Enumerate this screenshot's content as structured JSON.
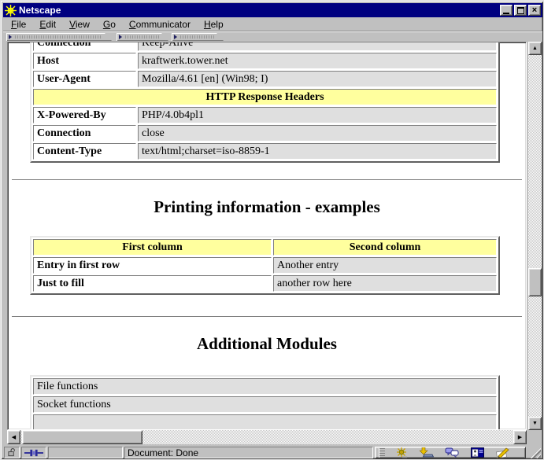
{
  "window": {
    "title": "Netscape"
  },
  "controls": {
    "close_glyph": "×"
  },
  "menu": {
    "items": [
      {
        "label": "File",
        "first": "F",
        "rest": "ile"
      },
      {
        "label": "Edit",
        "first": "E",
        "rest": "dit"
      },
      {
        "label": "View",
        "first": "V",
        "rest": "iew"
      },
      {
        "label": "Go",
        "first": "G",
        "rest": "o"
      },
      {
        "label": "Communicator",
        "first": "C",
        "rest": "ommunicator"
      },
      {
        "label": "Help",
        "first": "H",
        "rest": "elp"
      }
    ]
  },
  "content": {
    "http_table": {
      "request_rows": [
        {
          "name": "Connection",
          "value": "Keep-Alive"
        },
        {
          "name": "Host",
          "value": "kraftwerk.tower.net"
        },
        {
          "name": "User-Agent",
          "value": "Mozilla/4.61 [en] (Win98; I)"
        }
      ],
      "banner": "HTTP Response Headers",
      "response_rows": [
        {
          "name": "X-Powered-By",
          "value": "PHP/4.0b4pl1"
        },
        {
          "name": "Connection",
          "value": "close"
        },
        {
          "name": "Content-Type",
          "value": "text/html;charset=iso-8859-1"
        }
      ]
    },
    "printing": {
      "title": "Printing information - examples",
      "table": {
        "headers": [
          "First column",
          "Second column"
        ],
        "rows": [
          {
            "c1": "Entry in first row",
            "c2": "Another entry"
          },
          {
            "c1": "Just to fill",
            "c2": "another row here"
          }
        ]
      }
    },
    "modules": {
      "title": "Additional Modules",
      "rows": [
        "File functions",
        "Socket functions"
      ]
    }
  },
  "statusbar": {
    "document_status": "Document: Done"
  },
  "icons": {
    "scroll_up": "▲",
    "scroll_down": "▼",
    "scroll_left": "◀",
    "scroll_right": "▶"
  },
  "colors": {
    "title_blue": "#000080",
    "chrome_gray": "#c0c0c0",
    "header_yellow": "#ffff9e",
    "cell_gray": "#dfdfdf"
  }
}
